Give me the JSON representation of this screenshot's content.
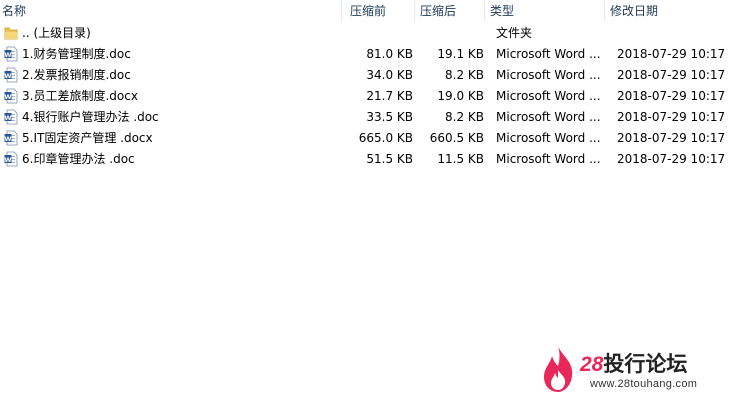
{
  "columns": {
    "name": "名称",
    "compressed_before": "压缩前",
    "compressed_after": "压缩后",
    "type": "类型",
    "modified": "修改日期"
  },
  "rows": [
    {
      "icon": "folder-icon",
      "name": ".. (上级目录)",
      "before": "",
      "after": "",
      "type": "文件夹",
      "modified": ""
    },
    {
      "icon": "word-doc-icon",
      "name": "1.财务管理制度.doc",
      "before": "81.0 KB",
      "after": "19.1 KB",
      "type": "Microsoft Word ...",
      "modified": "2018-07-29 10:17"
    },
    {
      "icon": "word-doc-icon",
      "name": "2.发票报销制度.doc",
      "before": "34.0 KB",
      "after": "8.2 KB",
      "type": "Microsoft Word ...",
      "modified": "2018-07-29 10:17"
    },
    {
      "icon": "word-doc-icon",
      "name": "3.员工差旅制度.docx",
      "before": "21.7 KB",
      "after": "19.0 KB",
      "type": "Microsoft Word ...",
      "modified": "2018-07-29 10:17"
    },
    {
      "icon": "word-doc-icon",
      "name": "4.银行账户管理办法 .doc",
      "before": "33.5 KB",
      "after": "8.2 KB",
      "type": "Microsoft Word ...",
      "modified": "2018-07-29 10:17"
    },
    {
      "icon": "word-doc-icon",
      "name": "5.IT固定资产管理 .docx",
      "before": "665.0 KB",
      "after": "660.5 KB",
      "type": "Microsoft Word ...",
      "modified": "2018-07-29 10:17"
    },
    {
      "icon": "word-doc-icon",
      "name": "6.印章管理办法 .doc",
      "before": "51.5 KB",
      "after": "11.5 KB",
      "type": "Microsoft Word ...",
      "modified": "2018-07-29 10:17"
    }
  ],
  "watermark": {
    "number": "28",
    "name": "投行论坛",
    "url": "www.28touhang.com",
    "brand_color": "#e8285a"
  }
}
